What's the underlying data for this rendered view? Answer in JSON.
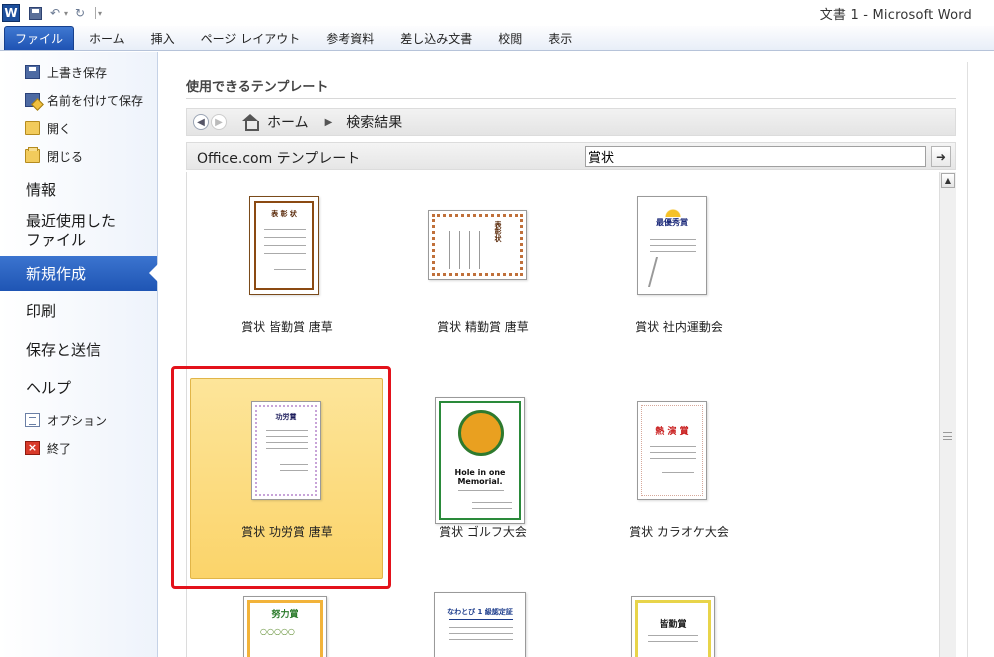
{
  "window": {
    "title": "文書 1  -  Microsoft Word",
    "app_icon": "W"
  },
  "qat": {
    "icons": [
      "word-icon",
      "save-icon",
      "undo-icon",
      "redo-icon",
      "customize-icon"
    ]
  },
  "ribbon": {
    "tabs": [
      {
        "label": "ファイル",
        "active": true
      },
      {
        "label": "ホーム"
      },
      {
        "label": "挿入"
      },
      {
        "label": "ページ レイアウト"
      },
      {
        "label": "参考資料"
      },
      {
        "label": "差し込み文書"
      },
      {
        "label": "校閲"
      },
      {
        "label": "表示"
      }
    ]
  },
  "leftnav": {
    "small_top": [
      {
        "label": "上書き保存",
        "icon": "save-icon"
      },
      {
        "label": "名前を付けて保存",
        "icon": "save-as-icon"
      },
      {
        "label": "開く",
        "icon": "open-folder-icon"
      },
      {
        "label": "閉じる",
        "icon": "close-folder-icon"
      }
    ],
    "info": "情報",
    "recent_line1": "最近使用した",
    "recent_line2": "ファイル",
    "new": "新規作成",
    "print": "印刷",
    "save_send": "保存と送信",
    "help": "ヘルプ",
    "small_bottom": [
      {
        "label": "オプション",
        "icon": "options-icon"
      },
      {
        "label": "終了",
        "icon": "exit-icon"
      }
    ]
  },
  "main": {
    "title": "使用できるテンプレート",
    "breadcrumb": {
      "home": "ホーム",
      "current": "検索結果"
    },
    "search": {
      "source_label": "Office.com テンプレート",
      "query": "賞状",
      "go": "➜"
    },
    "templates": [
      {
        "label": "賞状 皆勤賞 唐草",
        "thumb_title": "表 彰 状"
      },
      {
        "label": "賞状 精勤賞 唐草",
        "thumb_title": "表彰状"
      },
      {
        "label": "賞状 社内運動会",
        "thumb_title": "最優秀賞"
      },
      {
        "label": "賞状 功労賞 唐草",
        "thumb_title": "功労賞",
        "selected": true
      },
      {
        "label": "賞状 ゴルフ大会",
        "thumb_title": "Hole in one Memorial."
      },
      {
        "label": "賞状 カラオケ大会",
        "thumb_title": "熱 演 賞"
      },
      {
        "label": "",
        "thumb_title": "努力賞"
      },
      {
        "label": "",
        "thumb_title": "なわとび 1 級認定証"
      },
      {
        "label": "",
        "thumb_title": "皆勤賞"
      }
    ]
  }
}
